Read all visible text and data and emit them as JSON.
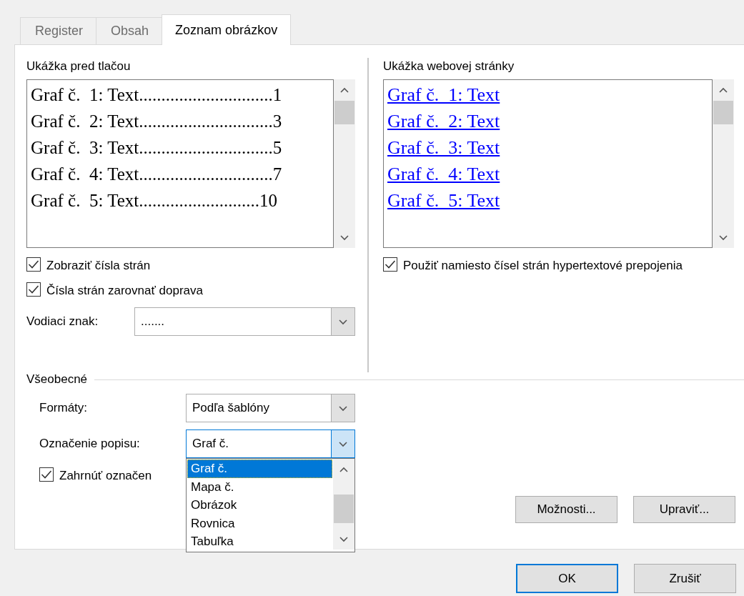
{
  "tabs": [
    {
      "label": "Register",
      "selected": false
    },
    {
      "label": "Obsah",
      "selected": false
    },
    {
      "label": "Zoznam obrázkov",
      "selected": true
    }
  ],
  "print_preview": {
    "label": "Ukážka pred tlačou",
    "entries": [
      {
        "caption": "Graf č.  1: Text",
        "leader": "..............................",
        "page": "1"
      },
      {
        "caption": "Graf č.  2: Text",
        "leader": "..............................",
        "page": "3"
      },
      {
        "caption": "Graf č.  3: Text",
        "leader": "..............................",
        "page": "5"
      },
      {
        "caption": "Graf č.  4: Text",
        "leader": "..............................",
        "page": "7"
      },
      {
        "caption": "Graf č.  5: Text",
        "leader": "...........................",
        "page": "10"
      }
    ]
  },
  "print_options": [
    {
      "label": "Zobraziť čísla strán",
      "checked": true
    },
    {
      "label": "Čísla strán zarovnať doprava",
      "checked": true
    }
  ],
  "tab_leader": {
    "label": "Vodiaci znak:",
    "value": "......."
  },
  "web_preview": {
    "label": "Ukážka webovej stránky",
    "entries": [
      "Graf č.  1: Text",
      "Graf č.  2: Text",
      "Graf č.  3: Text",
      "Graf č.  4: Text",
      "Graf č.  5: Text"
    ]
  },
  "web_option": {
    "label": "Použiť namiesto čísel strán hypertextové prepojenia",
    "checked": true
  },
  "general": {
    "title": "Všeobecné",
    "formats": {
      "label": "Formáty:",
      "value": "Podľa šablóny",
      "open": false
    },
    "caption_label": {
      "label": "Označenie popisu:",
      "value": "Graf č.",
      "open": true,
      "options": [
        {
          "label": "Graf č.",
          "selected": true
        },
        {
          "label": "Mapa č.",
          "selected": false
        },
        {
          "label": "Obrázok",
          "selected": false
        },
        {
          "label": "Rovnica",
          "selected": false
        },
        {
          "label": "Tabuľka",
          "selected": false
        }
      ]
    },
    "include_label": {
      "label": "Zahrnúť označen",
      "checked": true
    },
    "buttons": [
      "Možnosti...",
      "Upraviť..."
    ]
  },
  "buttons": [
    {
      "label": "OK",
      "default": true
    },
    {
      "label": "Zrušiť",
      "default": false
    }
  ]
}
